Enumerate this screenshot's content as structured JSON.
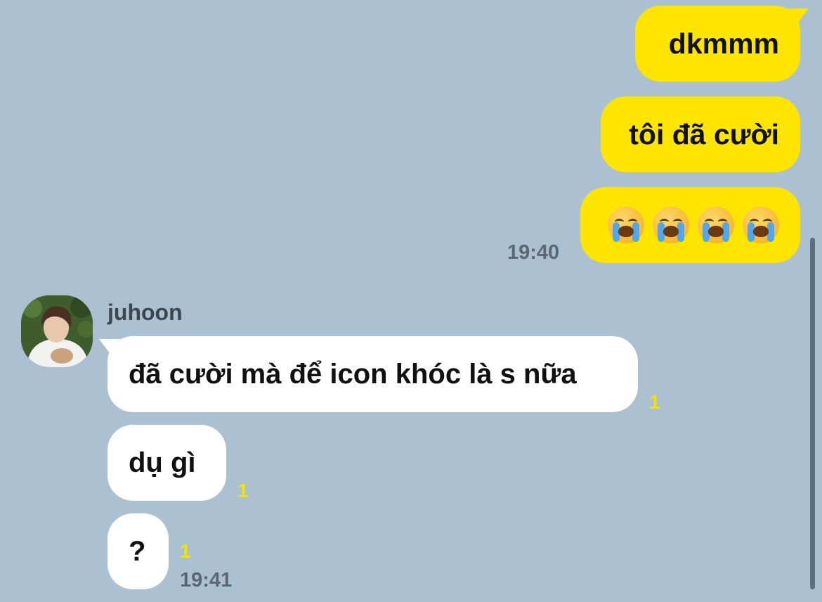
{
  "messages": {
    "sent": [
      {
        "text": "dkmmm"
      },
      {
        "text": "tôi đã cười"
      },
      {
        "emoji_count": 4,
        "emoji": "loudly-crying-face",
        "time": "19:40"
      }
    ],
    "received": {
      "sender": "juhoon",
      "items": [
        {
          "text": "đã cười mà để icon khóc là s nữa",
          "unread": "1"
        },
        {
          "text": "dụ gì",
          "unread": "1"
        },
        {
          "text": "?",
          "unread": "1",
          "time": "19:41"
        }
      ]
    }
  },
  "colors": {
    "background": "#abc1d1",
    "sent_bubble": "#fee500",
    "received_bubble": "#ffffff",
    "unread": "#f2e400"
  }
}
